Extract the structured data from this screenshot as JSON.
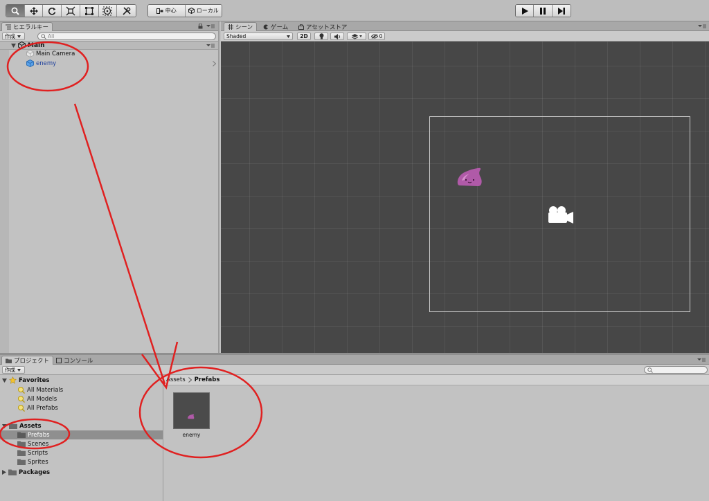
{
  "toolbar": {
    "tools": [
      "hand-icon",
      "move-icon",
      "rotate-icon",
      "scale-icon",
      "rect-icon",
      "transform-icon",
      "tools-icon"
    ],
    "pivot_label": "中心",
    "space_label": "ローカル",
    "playback": [
      "play-icon",
      "pause-icon",
      "step-icon"
    ]
  },
  "hierarchy": {
    "tab_label": "ヒエラルキー",
    "create_label": "作成",
    "search_placeholder": "All",
    "scene_name": "Main",
    "items": [
      {
        "label": "Main Camera"
      },
      {
        "label": "enemy"
      }
    ]
  },
  "scene_view": {
    "tabs": [
      {
        "label": "シーン"
      },
      {
        "label": "ゲーム"
      },
      {
        "label": "アセットストア"
      }
    ],
    "shading_mode": "Shaded",
    "mode_2d": "2D",
    "effects_count": "0",
    "colors": {
      "background": "#474747",
      "camera_frame": "#c9c9c9",
      "slime": "#b05aa8"
    }
  },
  "project": {
    "tabs": [
      {
        "label": "プロジェクト"
      },
      {
        "label": "コンソール"
      }
    ],
    "create_label": "作成",
    "favorites_label": "Favorites",
    "favorites": [
      "All Materials",
      "All Models",
      "All Prefabs"
    ],
    "assets_label": "Assets",
    "asset_folders": [
      "Prefabs",
      "Scenes",
      "Scripts",
      "Sprites"
    ],
    "packages_label": "Packages",
    "breadcrumb": [
      "Assets",
      "Prefabs"
    ],
    "files": [
      {
        "name": "enemy"
      }
    ]
  },
  "annotations": {
    "color": "#e02020"
  }
}
